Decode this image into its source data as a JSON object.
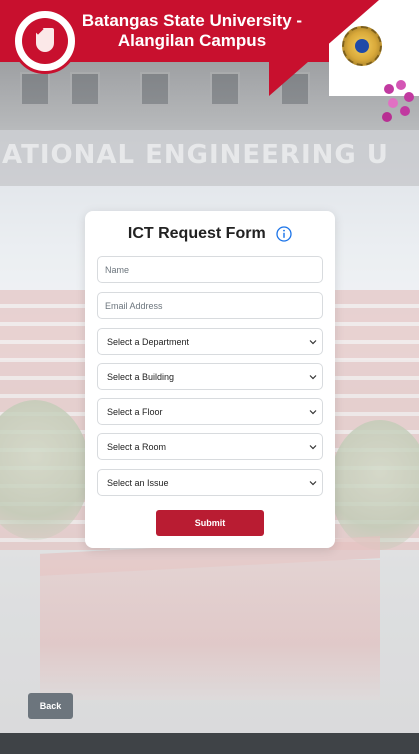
{
  "header": {
    "title_line1": "Batangas State University -",
    "title_line2": "Alangilan Campus",
    "left_logo_icon": "batstateu-seal-icon",
    "right_logo_icon": "college-gear-seal-icon",
    "brand_color": "#c8102e"
  },
  "background": {
    "banner_text": "ATIONAL ENGINEERING U"
  },
  "form": {
    "title": "ICT Request Form",
    "info_icon": "info-circle-icon",
    "name_placeholder": "Name",
    "email_placeholder": "Email Address",
    "department_select": "Select a Department",
    "building_select": "Select a Building",
    "floor_select": "Select a Floor",
    "room_select": "Select a Room",
    "issue_select": "Select an Issue",
    "submit_label": "Submit",
    "submit_color": "#b91c32"
  },
  "back_label": "Back",
  "back_color": "#6c757d"
}
